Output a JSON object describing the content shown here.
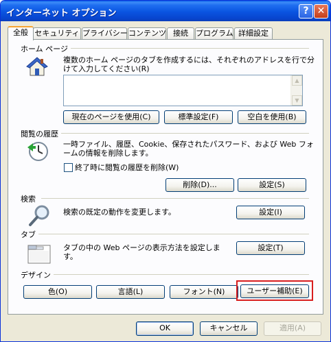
{
  "window": {
    "title": "インターネット オプション",
    "help": "?",
    "close": "✕"
  },
  "tabs": [
    {
      "label": "全般",
      "active": true
    },
    {
      "label": "セキュリティ"
    },
    {
      "label": "プライバシー"
    },
    {
      "label": "コンテンツ"
    },
    {
      "label": "接続"
    },
    {
      "label": "プログラム"
    },
    {
      "label": "詳細設定"
    }
  ],
  "home": {
    "label": "ホーム ページ",
    "desc": "複数のホーム ページのタブを作成するには、それぞれのアドレスを行で分けて入力してください(R)",
    "url_value": "",
    "btn_current": "現在のページを使用(C)",
    "btn_default": "標準設定(F)",
    "btn_blank": "空白を使用(B)"
  },
  "history": {
    "label": "閲覧の履歴",
    "desc": "一時ファイル、履歴、Cookie、保存されたパスワード、および Web フォームの情報を削除します。",
    "checkbox_label": "終了時に閲覧の履歴を削除(W)",
    "checked": false,
    "btn_delete": "削除(D)...",
    "btn_settings": "設定(S)"
  },
  "search": {
    "label": "検索",
    "desc": "検索の既定の動作を変更します。",
    "btn_settings": "設定(I)"
  },
  "tabs_group": {
    "label": "タブ",
    "desc": "タブの中の Web ページの表示方法を設定します。",
    "btn_settings": "設定(T)"
  },
  "design": {
    "label": "デザイン",
    "btn_colors": "色(O)",
    "btn_language": "言語(L)",
    "btn_fonts": "フォント(N)",
    "btn_accessibility": "ユーザー補助(E)"
  },
  "footer": {
    "ok": "OK",
    "cancel": "キャンセル",
    "apply": "適用(A)"
  }
}
